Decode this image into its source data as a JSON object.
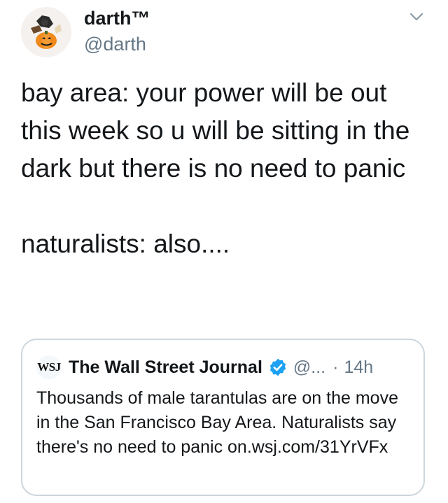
{
  "tweet": {
    "author": {
      "display_name": "darth™",
      "handle": "@darth",
      "avatar_icon": "halloween-pumpkin-avatar"
    },
    "text": "bay area: your power will be out this week so u will be sitting in the dark but there is no need to panic\n\nnaturalists: also....",
    "menu_icon": "chevron-down-icon"
  },
  "quote": {
    "logo_text": "WSJ",
    "name": "The Wall Street Journal",
    "verified": true,
    "handle": "@...",
    "separator": "·",
    "time": "14h",
    "text": "Thousands of male tarantulas are on the move in the San Francisco Bay Area. Naturalists say there's no need to panic on.wsj.com/31YrVFx"
  },
  "colors": {
    "text": "#14171a",
    "secondary": "#657786",
    "border": "#ccd6dd",
    "verified": "#1da1f2"
  }
}
